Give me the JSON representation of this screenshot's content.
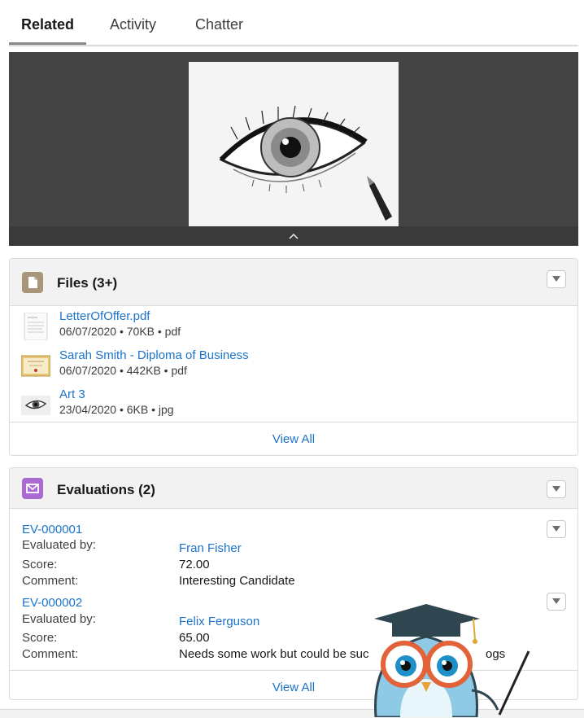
{
  "tabs": [
    "Related",
    "Activity",
    "Chatter"
  ],
  "files": {
    "title": "Files (3+)",
    "items": [
      {
        "name": "LetterOfOffer.pdf",
        "meta": "06/07/2020 • 70KB • pdf",
        "thumb": "document-thumbnail"
      },
      {
        "name": "Sarah Smith - Diploma of Business",
        "meta": "06/07/2020 • 442KB • pdf",
        "thumb": "certificate-thumbnail"
      },
      {
        "name": "Art 3",
        "meta": "23/04/2020 • 6KB • jpg",
        "thumb": "eye-thumbnail"
      }
    ],
    "view_all": "View All"
  },
  "evaluations": {
    "title": "Evaluations (2)",
    "labels": {
      "evaluated_by": "Evaluated by:",
      "score": "Score:",
      "comment": "Comment:"
    },
    "items": [
      {
        "id": "EV-000001",
        "evaluated_by": "Fran Fisher",
        "score": "72.00",
        "comment": "Interesting Candidate"
      },
      {
        "id": "EV-000002",
        "evaluated_by": "Felix Ferguson",
        "score": "65.00",
        "comment": "Needs some work but could be suc",
        "comment_tail": "ogs"
      }
    ],
    "view_all": "View All"
  },
  "colors": {
    "link": "#1b73c9",
    "files_icon": "#a8967a",
    "evaluations_icon": "#a96ad1",
    "preview_bg": "#444444"
  }
}
